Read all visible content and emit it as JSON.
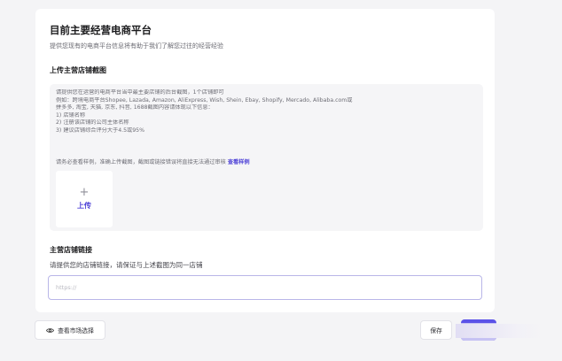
{
  "card": {
    "title": "目前主要经营电商平台",
    "subtitle": "提供您现有的电商平台信息将有助于我们了解您过往的经营经验"
  },
  "screenshot_section": {
    "label": "上传主营店铺截图",
    "instructions": [
      "请提供您在运营的电商平台当中最主要店铺的后台截图，1个店铺即可",
      "例如：跨境电商平台Shopee, Lazada, Amazon, AliExpress, Wish, Shein, Ebay, Shopify, Mercado, Alibaba.com或",
      "拼多多, 淘宝, 天猫, 京东, 抖音, 1688截图内容请体现以下信息：",
      "1) 店铺名称",
      "2) 注册该店铺的公司主体名称",
      "3) 建议店铺综合评分大于4.5或95%"
    ],
    "notice": "请务必查看样例，准确上传截图，截图或链接错误将直接无法通过审核",
    "notice_link": "查看样例",
    "upload_plus": "+",
    "upload_label": "上传"
  },
  "link_section": {
    "label": "主营店铺链接",
    "helper": "请提供您的店铺链接，请保证与上述截图为同一店铺",
    "input_placeholder": "https://",
    "input_value": ""
  },
  "footer": {
    "market_button": "查看市场选择",
    "save_button": "保存"
  },
  "colors": {
    "accent": "#5b52e8",
    "link": "#4b3fd6",
    "input_border": "#b9b6e8"
  }
}
